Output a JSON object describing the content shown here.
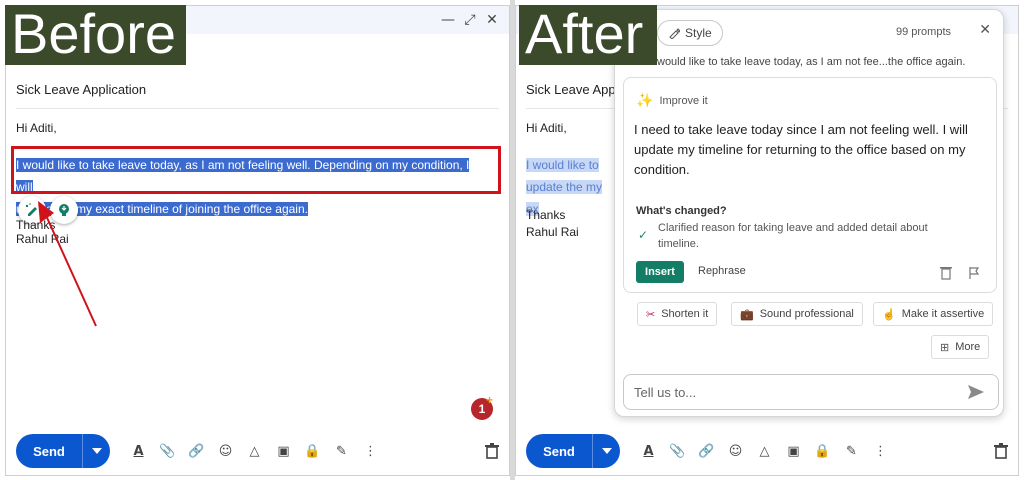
{
  "labels": {
    "before": "Before",
    "after": "After"
  },
  "email": {
    "subject": "Sick Leave Application",
    "greeting": "Hi Aditi,",
    "body_line1": "I would like to take leave today, as I am not feeling well. Depending on my condition, I will",
    "body_line2": "update the my exact timeline of joining the office again.",
    "after_line1": "I would like to",
    "after_line2": "update the my ex",
    "thanks": "Thanks",
    "thanks_partial": "Thanks",
    "name": "Rahul Rai",
    "after_subject": "Sick Leave App",
    "send_label": "Send",
    "badge_count": "1"
  },
  "ai": {
    "style_label": "Style",
    "prompts_label": "99 prompts",
    "original_excerpt": "would like to take leave today, as I am not fee...the office again.",
    "improve_label": "Improve it",
    "suggestion": "I need to take leave today since I am not feeling well. I will update my timeline for returning to the office based on my condition.",
    "changed_title": "What's changed?",
    "changed_desc": "Clarified reason for taking leave and added detail about timeline.",
    "insert_label": "Insert",
    "rephrase_label": "Rephrase",
    "options": [
      "Shorten it",
      "Sound professional",
      "Make it assertive",
      "More"
    ],
    "placeholder": "Tell us to..."
  },
  "colors": {
    "brand_blue": "#0b57d0",
    "highlight_red": "#d0131b",
    "insert_green": "#137d66",
    "label_bg": "#3b4a2b"
  }
}
